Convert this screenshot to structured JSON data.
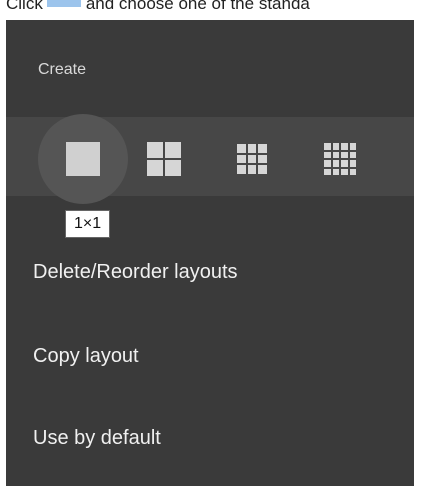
{
  "doc": {
    "before": "Click",
    "after": "and choose one of the standa"
  },
  "menu": {
    "section_label": "Create",
    "grid_options": [
      {
        "name": "1x1",
        "icon": "grid-1x1-icon",
        "active": true
      },
      {
        "name": "2x2",
        "icon": "grid-2x2-icon",
        "active": false
      },
      {
        "name": "3x3",
        "icon": "grid-3x3-icon",
        "active": false
      },
      {
        "name": "4x4",
        "icon": "grid-4x4-icon",
        "active": false
      }
    ],
    "tooltip": "1×1",
    "items": [
      {
        "label": "Delete/Reorder layouts"
      },
      {
        "label": "Copy layout"
      },
      {
        "label": "Use by default"
      }
    ]
  },
  "colors": {
    "menu_bg": "#3a3a3a",
    "row_bg": "#474747",
    "active_circle": "#555555",
    "icon": "#d6d6d6",
    "inline_chip": "#9cc4ec"
  }
}
